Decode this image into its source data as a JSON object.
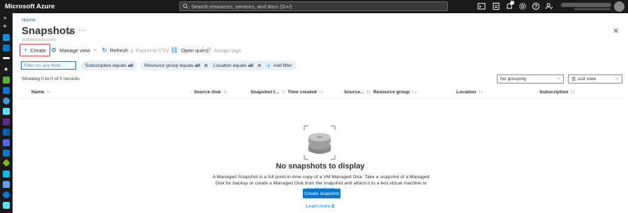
{
  "topbar": {
    "brand": "Microsoft Azure",
    "search_placeholder": "Search resources, services, and docs (G+/)",
    "icons": [
      "cloud-shell-icon",
      "directory-filter-icon",
      "notifications-icon",
      "settings-icon",
      "help-icon",
      "feedback-icon"
    ],
    "notification_count": "1"
  },
  "breadcrumb": "Home",
  "page": {
    "title": "Snapshots"
  },
  "toolbar": {
    "create": "Create",
    "manage_view": "Manage view",
    "refresh": "Refresh",
    "export_csv": "Export to CSV",
    "open_query": "Open query",
    "assign_tags": "Assign tags"
  },
  "filters": {
    "placeholder": "Filter for any field...",
    "pills": [
      {
        "label": "Subscription equals ",
        "value": "all"
      },
      {
        "label": "Resource group equals ",
        "value": "all"
      },
      {
        "label": "Location equals ",
        "value": "all"
      }
    ],
    "add_filter": "Add filter"
  },
  "records": "Showing 0 to 0 of 0 records.",
  "grouping": "No grouping",
  "view": "List view",
  "columns": [
    "Name",
    "Source disk",
    "Snapshot t...",
    "Time created",
    "Source...",
    "Resource group",
    "Location",
    "Subscription"
  ],
  "empty": {
    "title": "No snapshots to display",
    "description": "A Managed Snapshot is a full point-in-time copy of a VM Managed Disk. Take a snapshot of a Managed Disk for backup or create a Managed Disk from the snapshot and attach it to a test virtual machine to troubleshoot.",
    "button": "Create snapshot",
    "link": "Learn more"
  },
  "colors": {
    "accent": "#0078d4",
    "highlight": "#d13438",
    "topbar": "#1b1a19"
  }
}
